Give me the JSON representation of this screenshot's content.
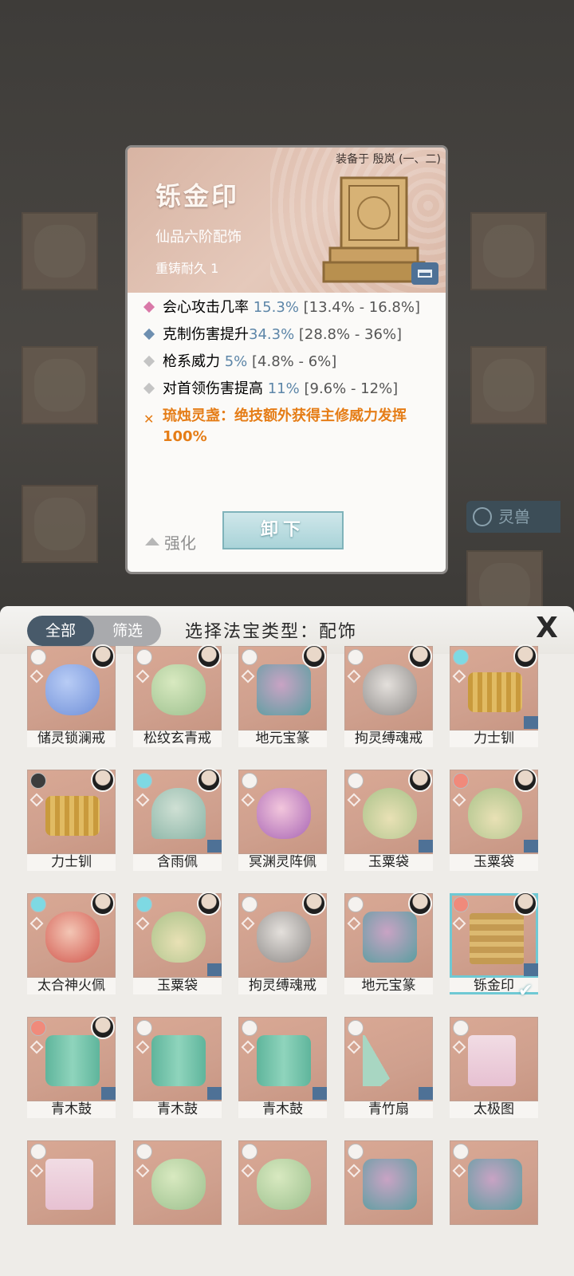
{
  "background": {
    "tab_label": "灵兽"
  },
  "detail": {
    "equipped_on": "装备于 殷岚 (一、二)",
    "name": "铄金印",
    "grade": "仙品六阶配饰",
    "reforge": "重铸耐久 1",
    "stats": [
      {
        "label": "会心攻击几率 ",
        "value": "15.3%",
        "range": " [13.4% - 16.8%]"
      },
      {
        "label": "克制伤害提升",
        "value": "34.3%",
        "range": " [28.8% - 36%]"
      },
      {
        "label": "枪系威力 ",
        "value": "5%",
        "range": " [4.8% - 6%]"
      },
      {
        "label": "对首领伤害提高 ",
        "value": "11%",
        "range": " [9.6% - 12%]"
      }
    ],
    "special": "琉烛灵盏：绝技额外获得主修威力发挥100%",
    "enhance_label": "强化",
    "unequip_label": "卸下"
  },
  "panel": {
    "seg_all": "全部",
    "seg_filter": "筛选",
    "title": "选择法宝类型：配饰",
    "close": "X",
    "items": [
      {
        "label": "储灵锁澜戒"
      },
      {
        "label": "松纹玄青戒"
      },
      {
        "label": "地元宝篆"
      },
      {
        "label": "拘灵缚魂戒"
      },
      {
        "label": "力士钏"
      },
      {
        "label": "力士钏"
      },
      {
        "label": "含雨佩"
      },
      {
        "label": "冥渊灵阵佩"
      },
      {
        "label": "玉粟袋"
      },
      {
        "label": "玉粟袋"
      },
      {
        "label": "太合神火佩"
      },
      {
        "label": "玉粟袋"
      },
      {
        "label": "拘灵缚魂戒"
      },
      {
        "label": "地元宝篆"
      },
      {
        "label": "铄金印"
      },
      {
        "label": "青木鼓"
      },
      {
        "label": "青木鼓"
      },
      {
        "label": "青木鼓"
      },
      {
        "label": "青竹扇"
      },
      {
        "label": "太极图"
      }
    ],
    "check_mark": "✔"
  }
}
